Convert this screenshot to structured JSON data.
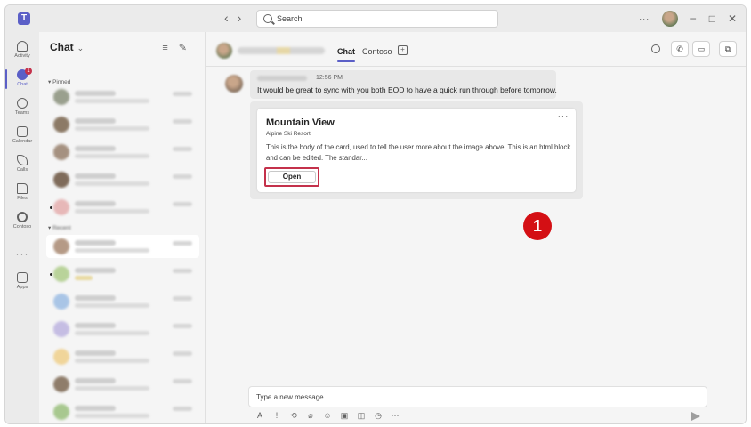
{
  "search": {
    "placeholder": "Search"
  },
  "titlebar": {
    "more": "···",
    "minimize": "−",
    "maximize": "□",
    "close": "✕"
  },
  "rail": {
    "items": [
      {
        "label": "Activity"
      },
      {
        "label": "Chat",
        "badge": "1"
      },
      {
        "label": "Teams"
      },
      {
        "label": "Calendar"
      },
      {
        "label": "Calls"
      },
      {
        "label": "Files"
      },
      {
        "label": "Contoso"
      },
      {
        "label": "Apps"
      }
    ],
    "more": "···"
  },
  "chatlist": {
    "title": "Chat",
    "sections": {
      "pinned": "Pinned",
      "recent": "Recent"
    }
  },
  "main": {
    "tabs": [
      {
        "label": "Chat"
      },
      {
        "label": "Contoso"
      }
    ],
    "message": {
      "time": "12:56 PM",
      "text": "It would be great to sync with you both EOD to have a quick run through before tomorrow."
    },
    "card": {
      "title": "Mountain View",
      "subtitle": "Alpine Ski Resort",
      "body": "This is the body of the card, used to tell the user more about the image above. This is an html block and can be edited. The standar...",
      "button": "Open",
      "more": "···"
    },
    "step_badge": "1",
    "composer": {
      "placeholder": "Type a new message"
    }
  },
  "colors": {
    "accent": "#5b5fc7",
    "highlight": "#c4314b",
    "badge": "#d40f14"
  }
}
